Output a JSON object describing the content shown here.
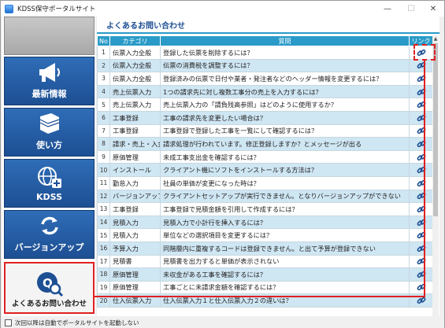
{
  "window": {
    "title": "KDSS保守ポータルサイト",
    "minimize": "—",
    "maximize": "☐",
    "close": "✕"
  },
  "sidebar": {
    "items": [
      {
        "label": "最新情報",
        "icon": "megaphone-icon"
      },
      {
        "label": "使い方",
        "icon": "book-icon"
      },
      {
        "label": "KDSS",
        "icon": "globe-plus-icon"
      },
      {
        "label": "バージョンアップ",
        "icon": "refresh-icon"
      },
      {
        "label": "よくあるお問い合わせ",
        "icon": "faq-search-icon"
      }
    ]
  },
  "content": {
    "title": "よくあるお問い合わせ",
    "columns": [
      "No",
      "カテゴリ",
      "質問",
      "リンク"
    ],
    "rows": [
      {
        "no": "1",
        "category": "伝票入力全般",
        "question": "登録した伝票を削除するには？"
      },
      {
        "no": "2",
        "category": "伝票入力全般",
        "question": "伝票の消費税を調整するには？"
      },
      {
        "no": "3",
        "category": "伝票入力全般",
        "question": "登録済みの伝票で日付や業者・発注者などのヘッダー情報を変更するには？"
      },
      {
        "no": "4",
        "category": "売上伝票入力",
        "question": "1つの請求先に対し複数工事分の売上を入力するには？"
      },
      {
        "no": "5",
        "category": "売上伝票入力",
        "question": "売上伝票入力の「請負残高参照」はどのように使用するか？"
      },
      {
        "no": "6",
        "category": "工事登録",
        "question": "工事の請求先を変更したい場合は？"
      },
      {
        "no": "7",
        "category": "工事登録",
        "question": "工事登録で登録した工事を一覧にして確認するには？"
      },
      {
        "no": "8",
        "category": "請求・売上・入金",
        "question": "請求処理が行われています。修正登録しますか？とメッセージが出る"
      },
      {
        "no": "9",
        "category": "原価管理",
        "question": "未成工事支出金を確認するには？"
      },
      {
        "no": "10",
        "category": "インストール",
        "question": "クライアント機にソフトをインストールする方法は？"
      },
      {
        "no": "11",
        "category": "勤怠入力",
        "question": "社員の単価が変更になった時は？"
      },
      {
        "no": "12",
        "category": "バージョンアップ",
        "question": "クライアントセットアップが実行できません。となりバージョンアップができない"
      },
      {
        "no": "13",
        "category": "工事登録",
        "question": "工事登録で見積金額を引用して作成するには？"
      },
      {
        "no": "14",
        "category": "見積入力",
        "question": "見積入力で小計行を挿入するには？"
      },
      {
        "no": "15",
        "category": "見積入力",
        "question": "単位などの選択項目を変更するには？"
      },
      {
        "no": "16",
        "category": "予算入力",
        "question": "同階層内に重複するコードは登録できません。と出て予算が登録できない"
      },
      {
        "no": "17",
        "category": "見積書",
        "question": "見積書を出力すると単価が表示されない"
      },
      {
        "no": "18",
        "category": "原価管理",
        "question": "未収金がある工事を確認するには？"
      },
      {
        "no": "19",
        "category": "原価管理",
        "question": "工事ごとに未請求金額を確認するには？"
      },
      {
        "no": "20",
        "category": "仕入伝票入力",
        "question": "仕入伝票入力１と仕入伝票入力２の違いは？"
      }
    ]
  },
  "footer": {
    "checkbox_label": "次回以降は自動でポータルサイトを起動しない"
  },
  "colors": {
    "accent": "#2a9bc8",
    "sidebar": "#1d4f93",
    "highlight": "#e02020"
  }
}
